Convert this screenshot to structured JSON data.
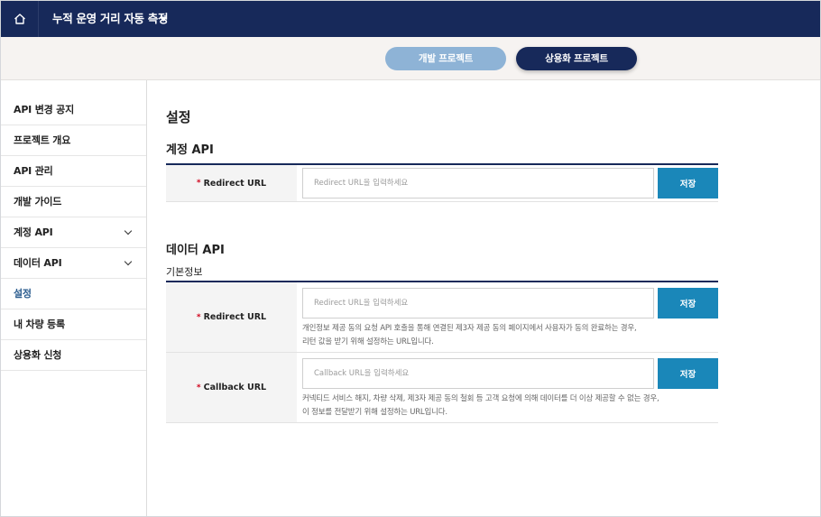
{
  "header": {
    "project_title": "누적 운영 거리 자동 측정"
  },
  "env": {
    "dev_label": "개발 프로젝트",
    "prod_label": "상용화 프로젝트"
  },
  "sidebar": {
    "items": [
      {
        "label": "API 변경 공지"
      },
      {
        "label": "프로젝트 개요"
      },
      {
        "label": "API 관리"
      },
      {
        "label": "개발 가이드"
      },
      {
        "label": "계정 API"
      },
      {
        "label": "데이터 API"
      },
      {
        "label": "설정"
      },
      {
        "label": "내 차량 등록"
      },
      {
        "label": "상용화 신청"
      }
    ],
    "active": "설정"
  },
  "main": {
    "page_title": "설정",
    "account_section": {
      "title": "계정 API",
      "redirect_label": "Redirect URL",
      "redirect_placeholder": "Redirect URL을 입력하세요",
      "save_label": "저장"
    },
    "data_section": {
      "title": "데이터 API",
      "subtitle": "기본정보",
      "redirect_label": "Redirect URL",
      "redirect_placeholder": "Redirect URL을 입력하세요",
      "redirect_save_label": "저장",
      "redirect_help_1": "개인정보 제공 동의 요청 API 호출을 통해 연결된 제3자 제공 동의 페이지에서 사용자가 동의 완료하는 경우,",
      "redirect_help_2": "리턴 값을 받기 위해 설정하는 URL입니다.",
      "callback_label": "Callback URL",
      "callback_placeholder": "Callback URL을 입력하세요",
      "callback_save_label": "저장",
      "callback_help_1": "커넥티드 서비스 해지, 차량 삭제, 제3자 제공 동의 철회 등 고객 요청에 의해 데이터를 더 이상 제공할 수 없는 경우,",
      "callback_help_2": "이 정보를 전달받기 위해 설정하는 URL입니다."
    },
    "required_mark": "*"
  },
  "colors": {
    "navy": "#17295a",
    "accent_blue": "#1a87b9",
    "dev_button": "#8eb3d6",
    "required": "#d0021b"
  }
}
